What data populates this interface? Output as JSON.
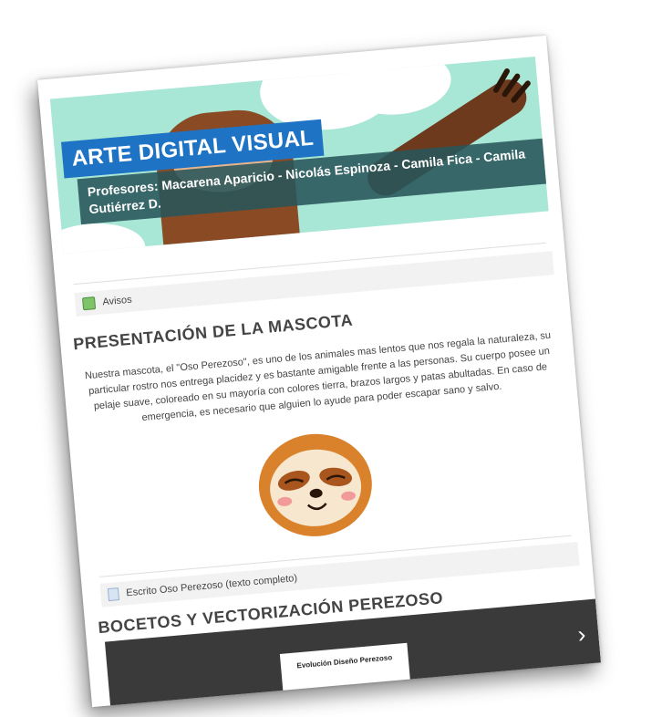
{
  "banner": {
    "title": "ARTE DIGITAL VISUAL",
    "teachers": "Profesores:  Macarena Aparicio - Nicolás Espinoza - Camila Fica - Camila Gutiérrez D."
  },
  "avisos": {
    "label": "Avisos",
    "icon": "forum-icon"
  },
  "section1": {
    "title": "PRESENTACIÓN DE LA MASCOTA",
    "text": "Nuestra mascota, el \"Oso Perezoso\", es uno de los animales mas lentos que nos regala la naturaleza, su particular rostro nos entrega placidez y es bastante amigable frente a las personas. Su cuerpo posee un pelaje suave, coloreado en su mayoría con colores tierra, brazos largos y patas abultadas. En caso de emergencia, es necesario que alguien lo ayude para poder escapar sano y salvo.",
    "document_link": "Escrito Oso Perezoso (texto completo)"
  },
  "section2": {
    "title": "BOCETOS Y VECTORIZACIÓN PEREZOSO",
    "video_card_title": "Evolución Diseño Perezoso"
  },
  "colors": {
    "banner_bg": "#a8e6d6",
    "title_bg": "#1f73c4",
    "teachers_bg": "#28555a",
    "sloth_brown": "#8a4a24",
    "video_bg": "#3a3a3a"
  }
}
